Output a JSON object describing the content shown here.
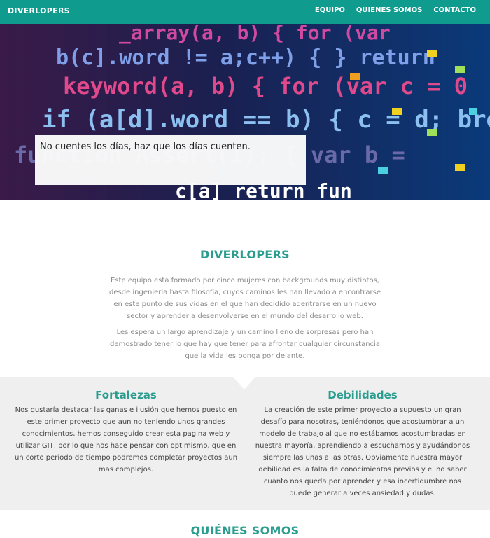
{
  "navbar": {
    "brand": "DIVERLOPERS",
    "links": [
      "EQUIPO",
      "QUIENES SOMOS",
      "CONTACTO"
    ]
  },
  "hero": {
    "quote": "No cuentes los días, haz que los días cuenten.",
    "code_lines": [
      "_array(a, b) { for (var",
      "b(c].word != a;c++) { } return",
      "keyword(a, b) { for (var c = 0",
      "if (a[d].word == b) { c = d; break",
      "function Assert(1); { var b =",
      "c[a] return fun"
    ]
  },
  "intro": {
    "title": "DIVERLOPERS",
    "paragraph1": "Este equipo está formado por cinco mujeres con backgrounds muy distintos, desde ingeniería hasta filosofía, cuyos caminos les han llevado a encontrarse en este punto de sus vidas en el que han decidido adentrarse en un nuevo sector y aprender a desenvolverse en el mundo del desarrollo web.",
    "paragraph2": "Les espera un largo aprendizaje y un camino lleno de sorpresas pero han demostrado tener lo que hay que tener para afrontar cualquier circunstancia que la vida les ponga por delante."
  },
  "strengths": {
    "title": "Fortalezas",
    "text": "Nos gustaría destacar las ganas e ilusión que hemos puesto en este primer proyecto que aun no teniendo unos grandes conocimientos, hemos conseguido crear esta pagina web y utilizar GIT, por lo que nos hace pensar con optimismo, que en un corto periodo de tiempo podremos completar proyectos aun mas complejos."
  },
  "weaknesses": {
    "title": "Debilidades",
    "text": "La creación de este primer proyecto a supuesto un gran desafío para nosotras, teniéndonos que acostumbrar a un modelo de trabajo al que no estábamos acostumbradas en nuestra mayoría, aprendiendo a escucharnos y ayudándonos siempre las unas a las otras. Obviamente nuestra mayor debilidad es la falta de conocimientos previos y el no saber cuánto nos queda por aprender y esa incertidumbre nos puede generar a veces ansiedad y dudas."
  },
  "about": {
    "title": "QUIÉNES SOMOS"
  },
  "colors": {
    "primary": "#0f9b8e",
    "heading": "#2a9d8f",
    "band": "#efefef"
  }
}
